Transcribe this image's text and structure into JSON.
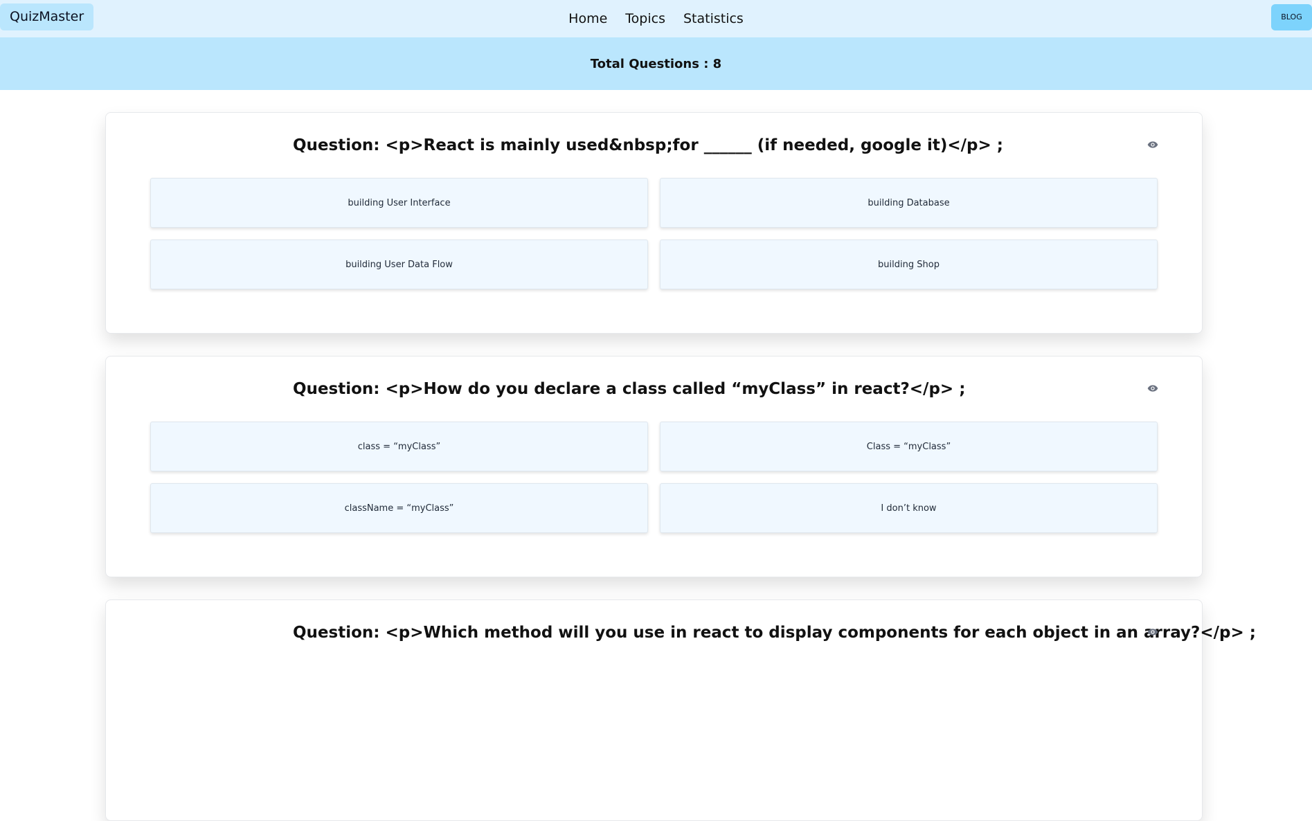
{
  "navbar": {
    "brand": "QuizMaster",
    "links": [
      "Home",
      "Topics",
      "Statistics"
    ],
    "blog_label": "BLOG"
  },
  "banner": {
    "total_label": "Total Questions : 8"
  },
  "questions": [
    {
      "title": "Question: <p>React is mainly used&nbsp;for ______ (if needed, google it)</p> ;",
      "options": [
        "building User Interface",
        "building Database",
        "building User Data Flow",
        "building Shop"
      ]
    },
    {
      "title": "Question: <p>How do you declare a class called “myClass” in react?</p> ;",
      "options": [
        "class = “myClass”",
        "Class = “myClass”",
        "className = “myClass”",
        "I don’t know"
      ]
    },
    {
      "title": "Question: <p>Which method will you use in react to display components for each object in an array?</p> ;",
      "options": []
    }
  ],
  "icons": {
    "reveal": "eye-icon"
  },
  "colors": {
    "navbar_bg": "#e0f2fe",
    "banner_bg": "#bae6fd",
    "blog_button_bg": "#7dd3fc",
    "option_bg": "#f0f8ff"
  }
}
